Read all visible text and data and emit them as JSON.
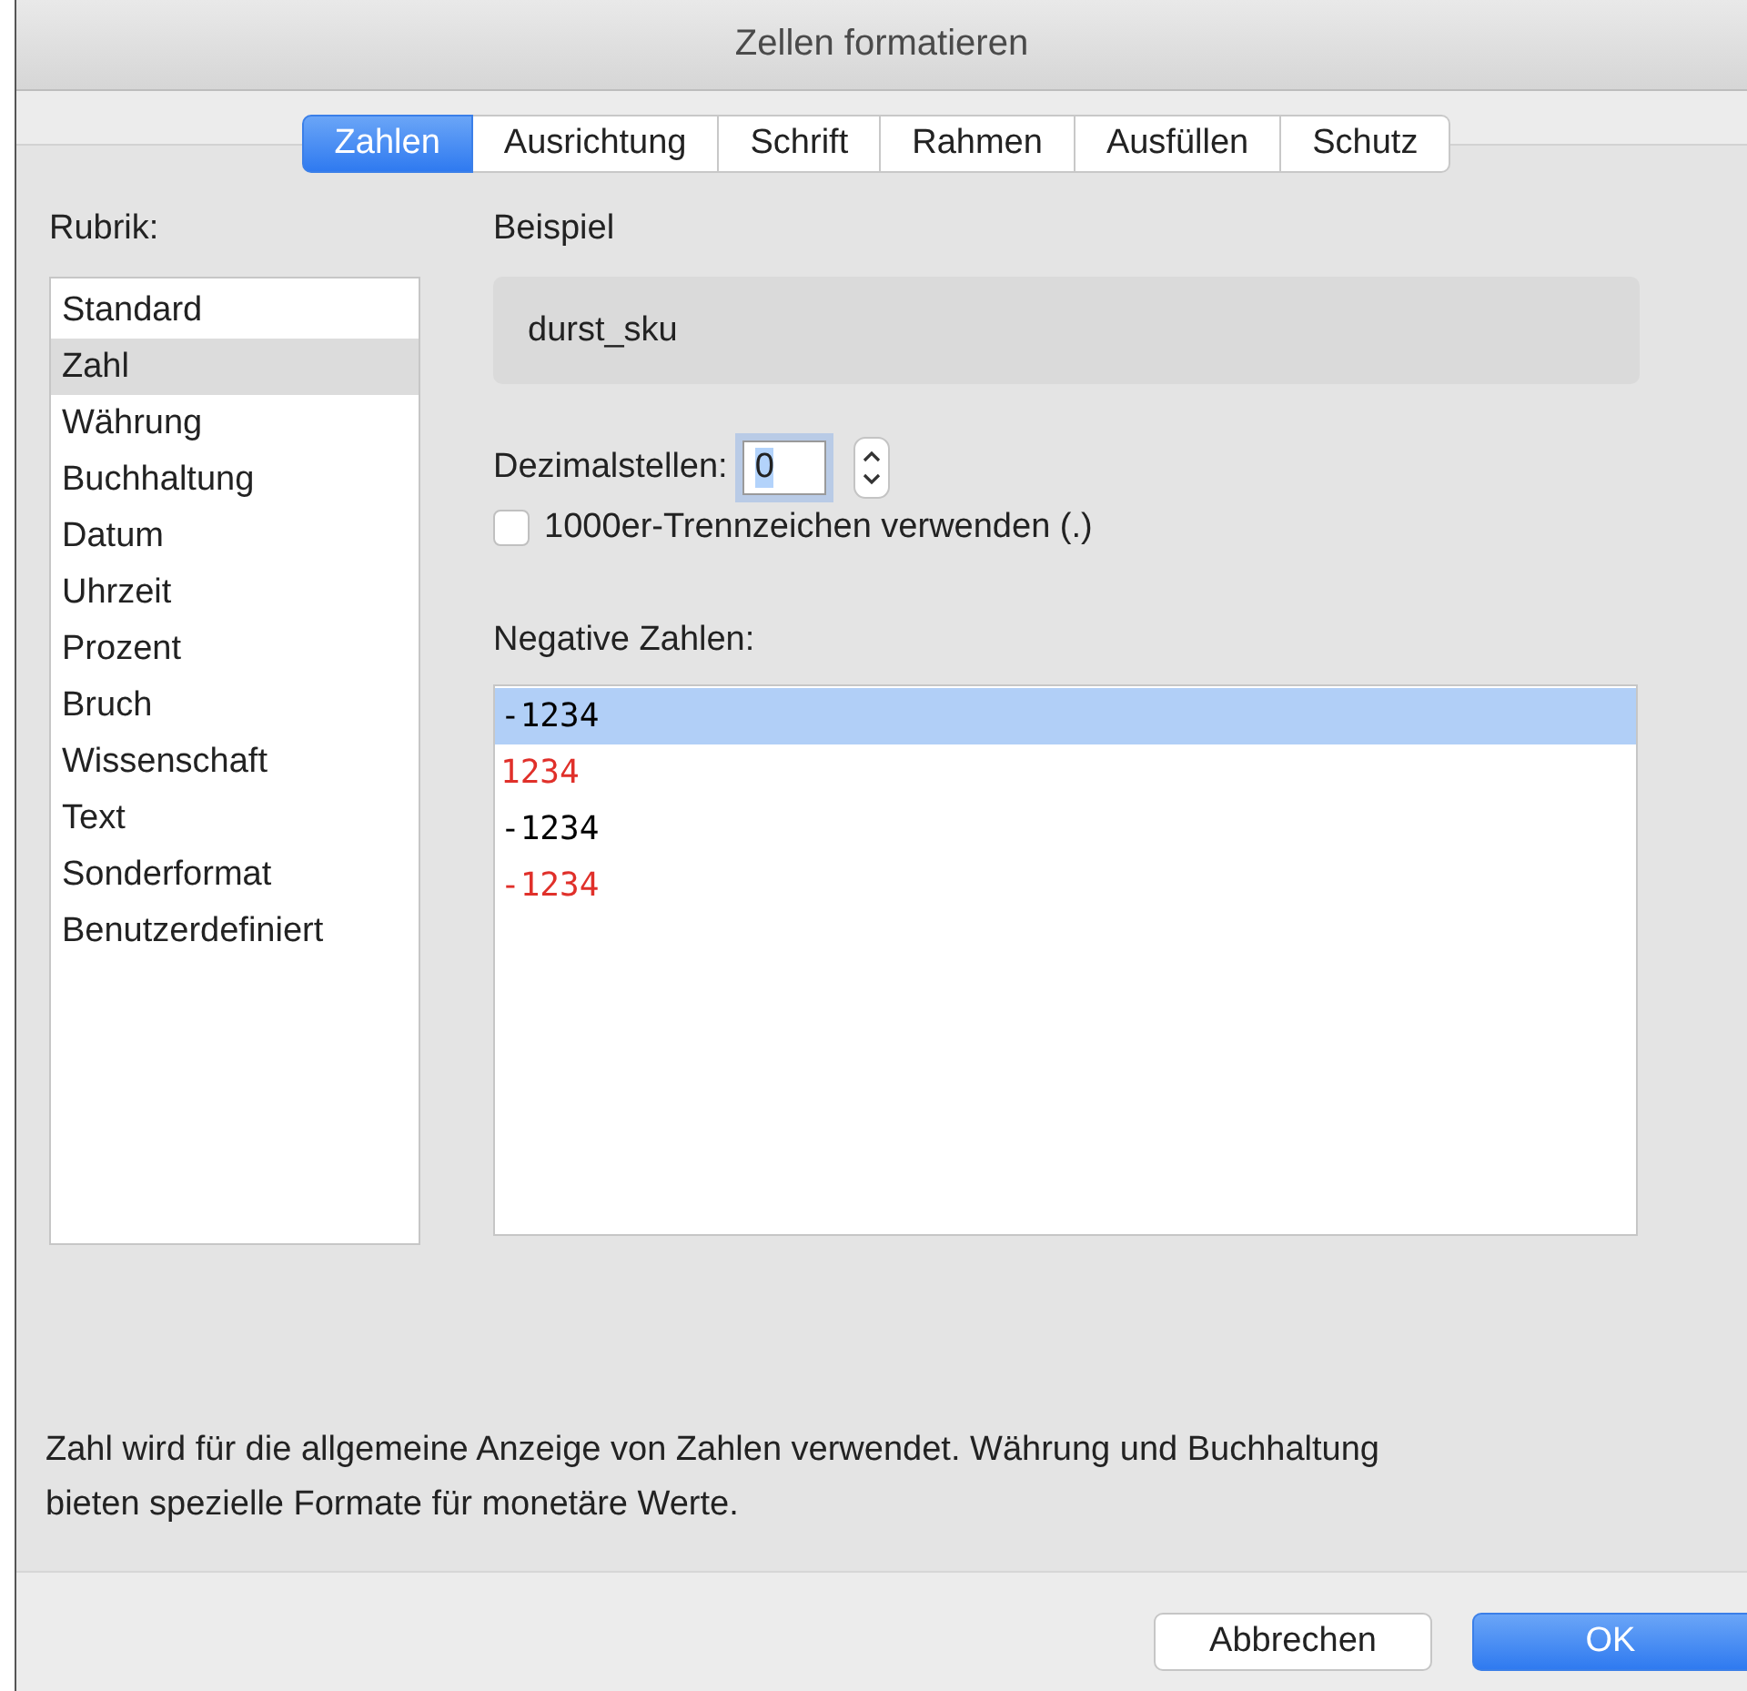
{
  "window": {
    "title": "Zellen formatieren"
  },
  "tabs": [
    {
      "label": "Zahlen",
      "selected": true
    },
    {
      "label": "Ausrichtung",
      "selected": false
    },
    {
      "label": "Schrift",
      "selected": false
    },
    {
      "label": "Rahmen",
      "selected": false
    },
    {
      "label": "Ausfüllen",
      "selected": false
    },
    {
      "label": "Schutz",
      "selected": false
    }
  ],
  "category": {
    "label": "Rubrik:",
    "items": [
      {
        "label": "Standard",
        "selected": false
      },
      {
        "label": "Zahl",
        "selected": true
      },
      {
        "label": "Währung",
        "selected": false
      },
      {
        "label": "Buchhaltung",
        "selected": false
      },
      {
        "label": "Datum",
        "selected": false
      },
      {
        "label": "Uhrzeit",
        "selected": false
      },
      {
        "label": "Prozent",
        "selected": false
      },
      {
        "label": "Bruch",
        "selected": false
      },
      {
        "label": "Wissenschaft",
        "selected": false
      },
      {
        "label": "Text",
        "selected": false
      },
      {
        "label": "Sonderformat",
        "selected": false
      },
      {
        "label": "Benutzerdefiniert",
        "selected": false
      }
    ]
  },
  "sample": {
    "label": "Beispiel",
    "value": "durst_sku"
  },
  "decimals": {
    "label": "Dezimalstellen:",
    "value": "0"
  },
  "thousands_separator": {
    "label": "1000er-Trennzeichen verwenden (.)",
    "checked": false
  },
  "negative_numbers": {
    "label": "Negative Zahlen:",
    "items": [
      {
        "text": "-1234",
        "color": "#000000",
        "selected": true
      },
      {
        "text": "1234",
        "color": "#e0302a",
        "selected": false
      },
      {
        "text": "-1234",
        "color": "#000000",
        "selected": false
      },
      {
        "text": "-1234",
        "color": "#e0302a",
        "selected": false
      }
    ]
  },
  "description": "Zahl wird für die allgemeine Anzeige von Zahlen verwendet. Währung und Buchhaltung bieten spezielle Formate für monetäre Werte.",
  "buttons": [
    {
      "label": "Abbrechen",
      "kind": "secondary"
    },
    {
      "label": "OK",
      "kind": "default"
    }
  ]
}
